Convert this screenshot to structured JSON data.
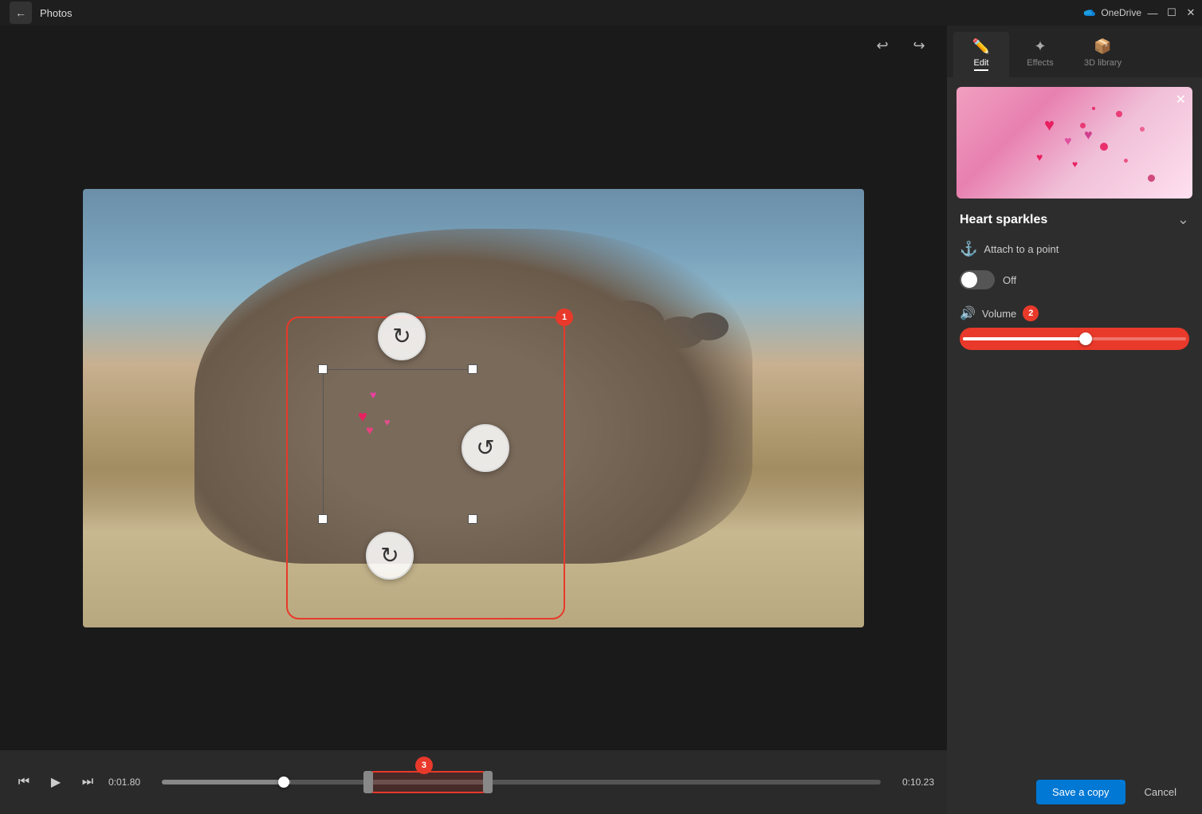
{
  "app": {
    "title": "Photos",
    "back_btn": "←"
  },
  "titlebar": {
    "onedrive_label": "OneDrive",
    "minimize": "—",
    "maximize": "☐",
    "close": "✕"
  },
  "toolbar": {
    "undo_icon": "↩",
    "redo_icon": "↪"
  },
  "playback": {
    "skip_back_icon": "⏮",
    "play_icon": "▶",
    "step_icon": "⏭",
    "current_time": "0:01.80",
    "end_time": "0:10.23"
  },
  "timeline": {
    "range_number": "3"
  },
  "panel": {
    "tabs": [
      {
        "id": "edit",
        "label": "Edit",
        "icon": "✏️",
        "active": true
      },
      {
        "id": "effects",
        "label": "Effects",
        "icon": "✦",
        "active": false
      },
      {
        "id": "3dlibrary",
        "label": "3D library",
        "icon": "📦",
        "active": false
      }
    ]
  },
  "effect": {
    "title": "Heart sparkles",
    "close_icon": "✕",
    "collapse_icon": "⌄",
    "attach_icon": "⚓",
    "attach_label": "Attach to a point",
    "toggle_state": "off",
    "toggle_label": "Off",
    "volume_icon": "🔊",
    "volume_label": "Volume",
    "volume_badge": "2",
    "selection_number": "1"
  },
  "buttons": {
    "save_copy": "Save a copy",
    "cancel": "Cancel"
  }
}
